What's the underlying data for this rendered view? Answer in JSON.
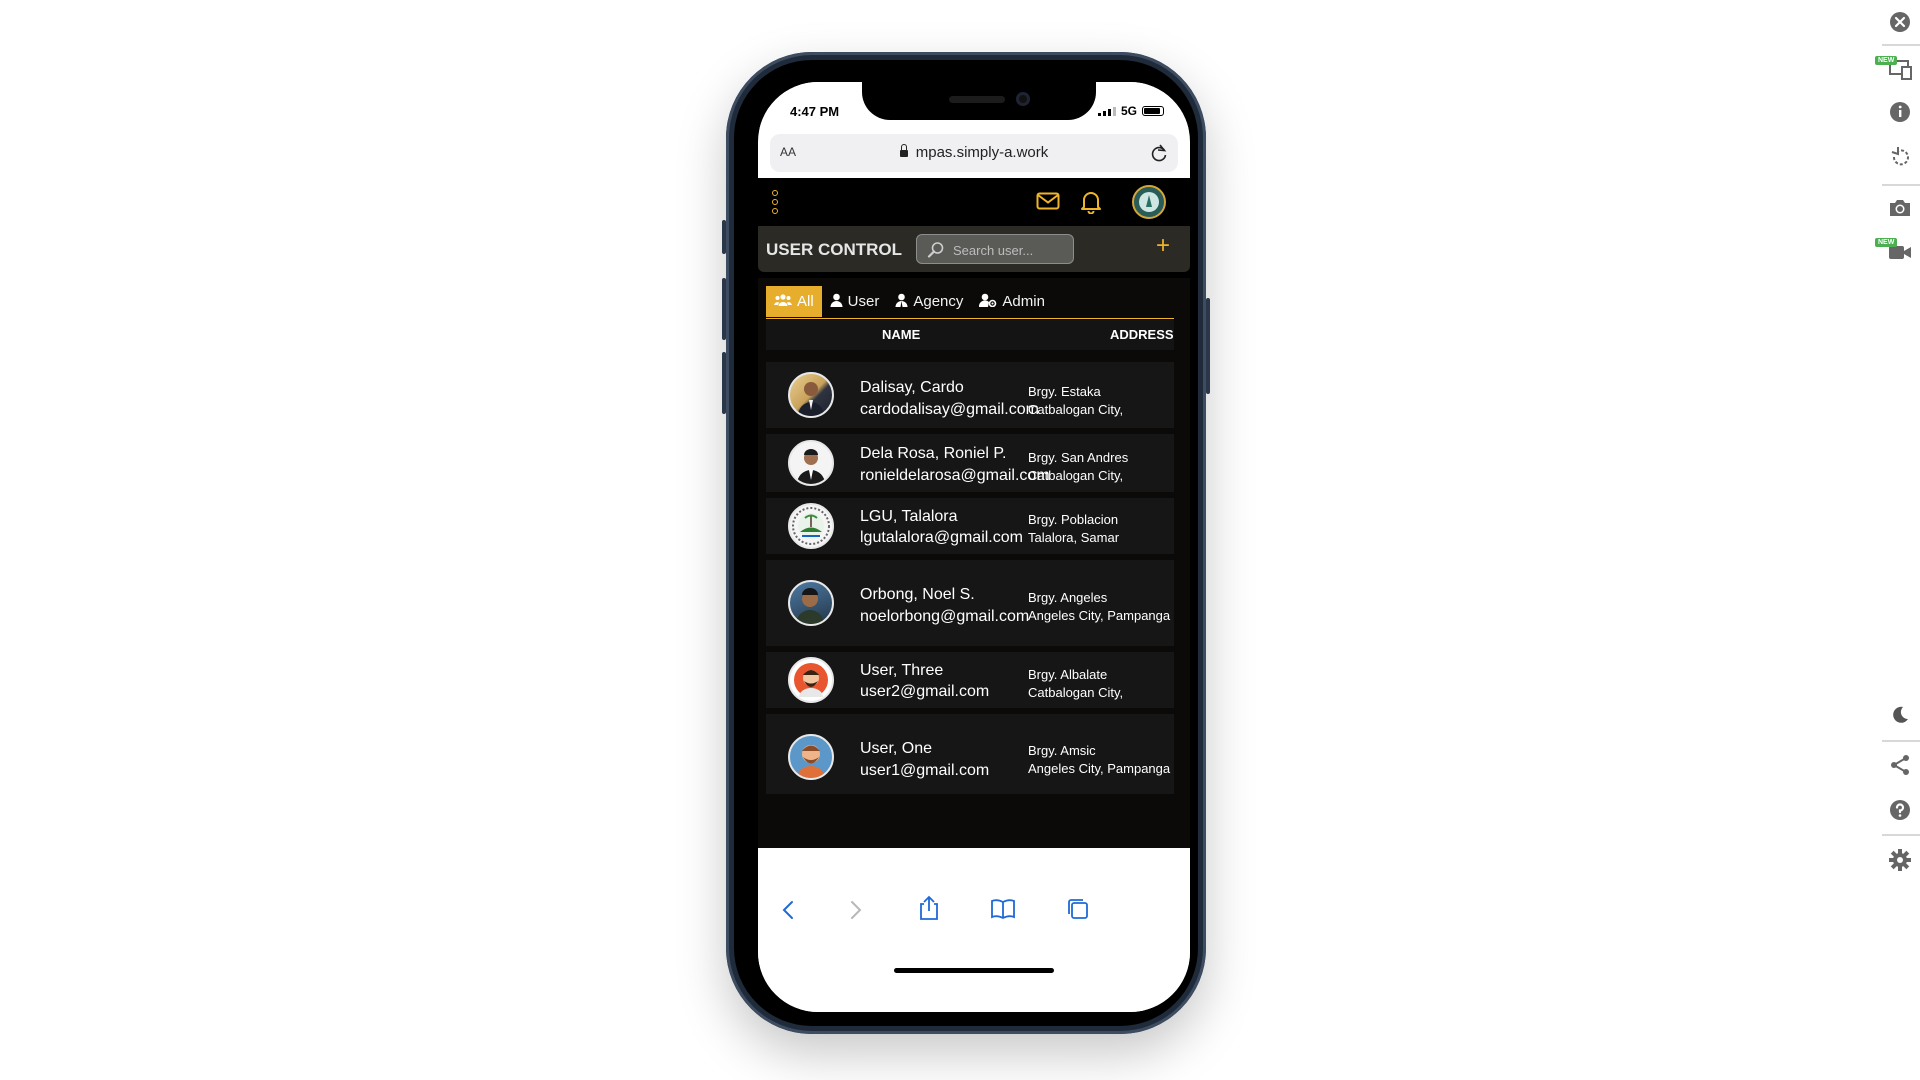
{
  "status_bar": {
    "time": "4:47 PM",
    "network": "5G"
  },
  "browser": {
    "text_size_label": "AA",
    "url": "mpas.simply-a.work"
  },
  "app": {
    "section_title": "USER CONTROL",
    "search_placeholder": "Search user...",
    "add_label": "+",
    "accent_color": "#f0b429",
    "tabs": [
      {
        "label": "All",
        "icon": "users-group-icon",
        "active": true
      },
      {
        "label": "User",
        "icon": "user-icon",
        "active": false
      },
      {
        "label": "Agency",
        "icon": "agency-user-icon",
        "active": false
      },
      {
        "label": "Admin",
        "icon": "admin-user-icon",
        "active": false
      }
    ],
    "columns": [
      "NAME",
      "ADDRESS"
    ],
    "users": [
      {
        "name": "Dalisay, Cardo",
        "email": "cardodalisay@gmail.com",
        "address_line1": "Brgy. Estaka",
        "address_line2": "Catbalogan City,"
      },
      {
        "name": "Dela Rosa, Roniel P.",
        "email": "ronieldelarosa@gmail.com",
        "address_line1": "Brgy. San Andres",
        "address_line2": "Catbalogan City,"
      },
      {
        "name": "LGU, Talalora",
        "email": "lgutalalora@gmail.com",
        "address_line1": "Brgy. Poblacion",
        "address_line2": "Talalora, Samar"
      },
      {
        "name": "Orbong, Noel S.",
        "email": "noelorbong@gmail.com",
        "address_line1": "Brgy. Angeles",
        "address_line2": "Angeles City, Pampanga"
      },
      {
        "name": "User, Three",
        "email": "user2@gmail.com",
        "address_line1": "Brgy. Albalate",
        "address_line2": "Catbalogan City,"
      },
      {
        "name": "User, One",
        "email": "user1@gmail.com",
        "address_line1": "Brgy. Amsic",
        "address_line2": "Angeles City, Pampanga"
      }
    ]
  },
  "right_toolbar": {
    "new_badge": "NEW",
    "items": [
      "close-icon",
      "device-select-icon",
      "info-icon",
      "rotate-icon",
      "screenshot-icon",
      "record-video-icon",
      "dark-mode-icon",
      "share-icon",
      "help-icon",
      "settings-icon"
    ]
  }
}
